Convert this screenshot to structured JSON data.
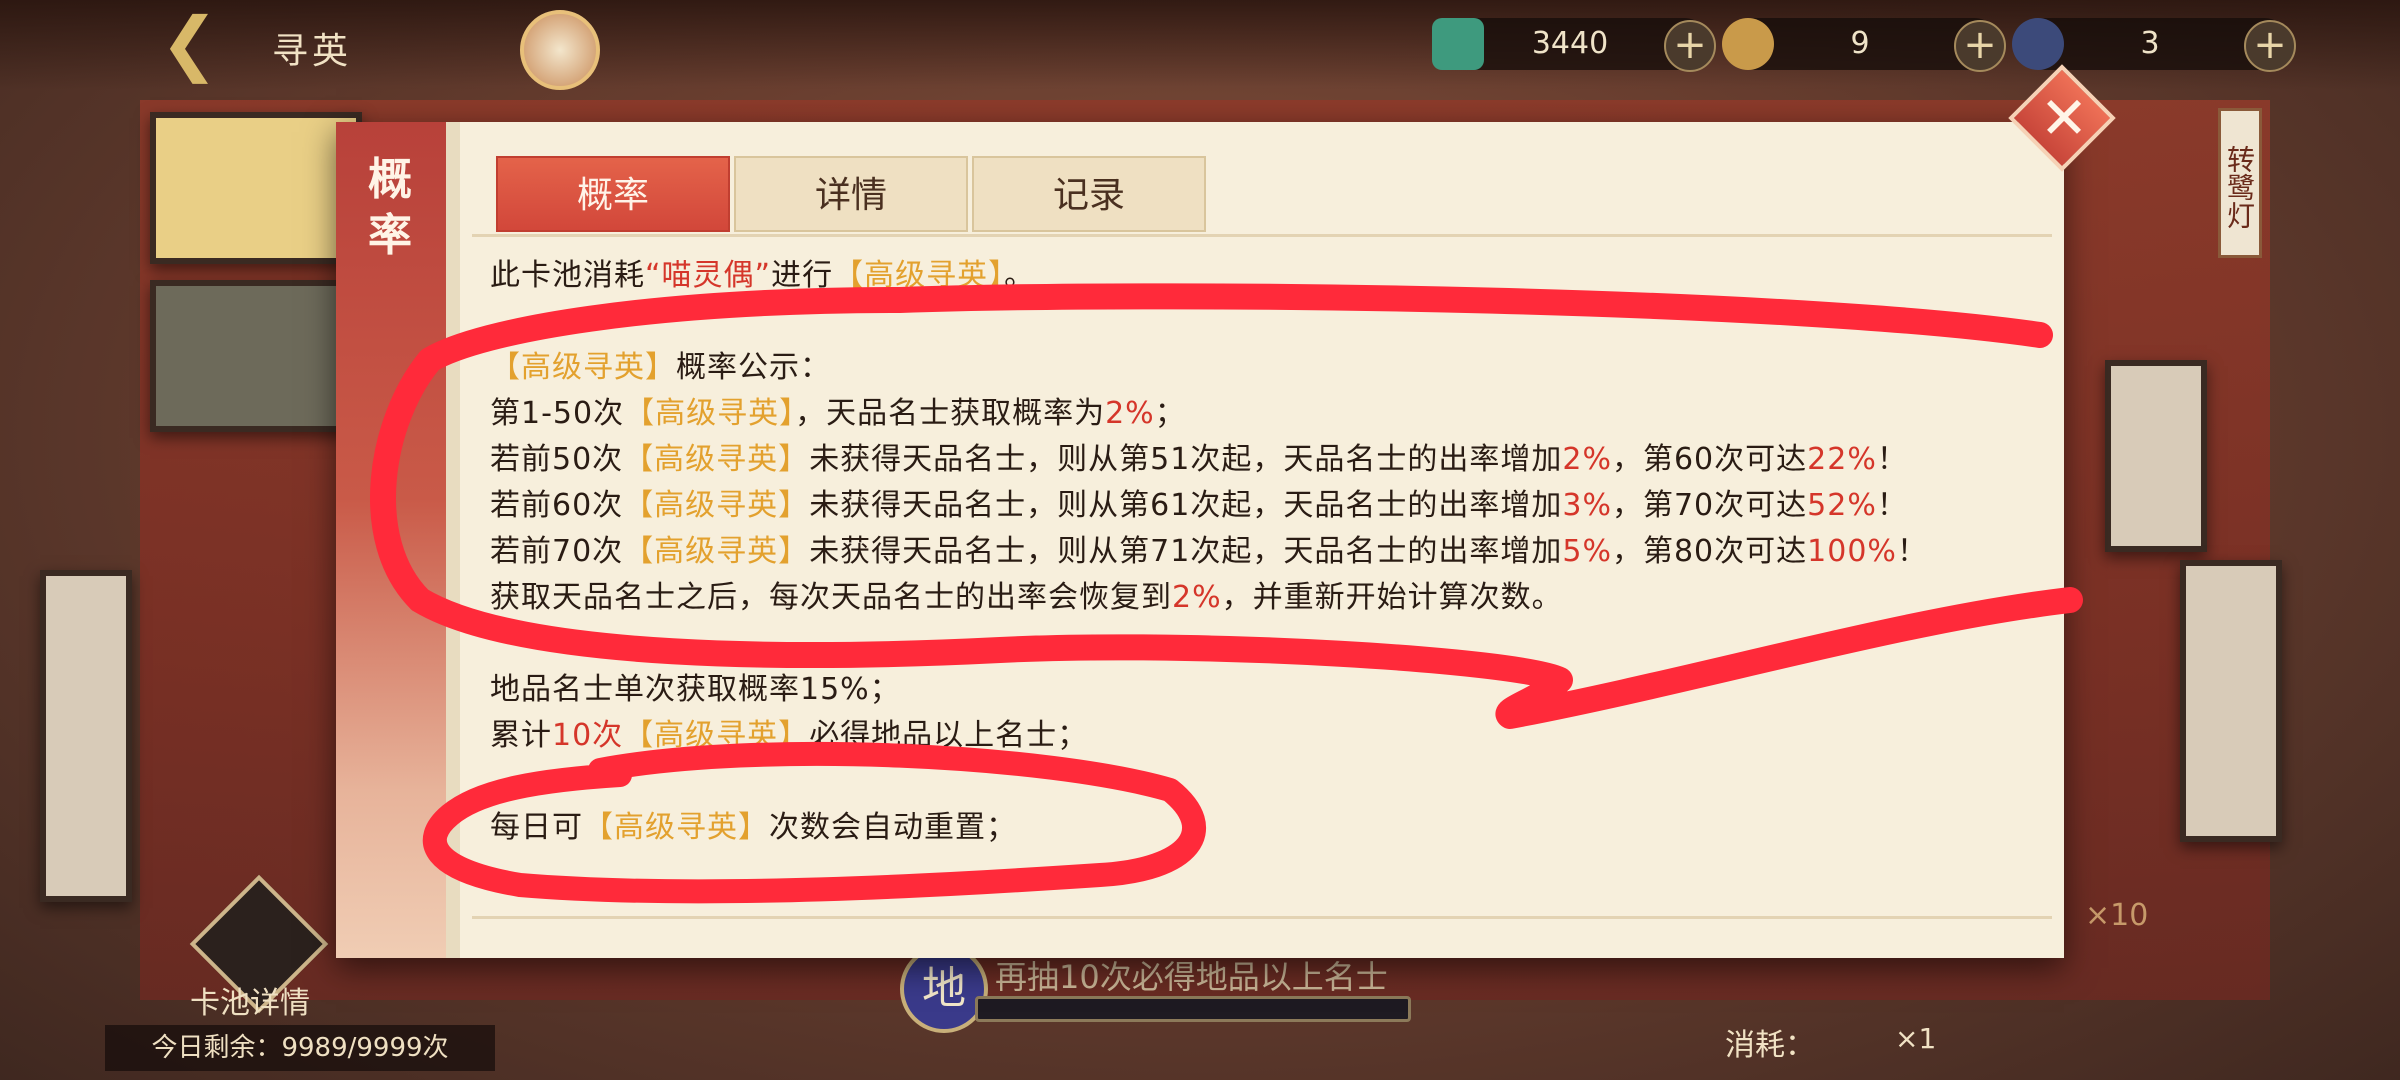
{
  "header": {
    "title": "寻英",
    "back_icon": "back-arrow-icon",
    "currencies": [
      {
        "icon": "jade-icon",
        "value": "3440"
      },
      {
        "icon": "cat-doll-icon",
        "value": "9"
      },
      {
        "icon": "wolf-token-icon",
        "value": "3"
      }
    ],
    "plus_label": "+"
  },
  "background": {
    "pool_details_label": "卡池详情",
    "daily_remaining": "今日剩余：9989/9999次",
    "bottom_badge": "地",
    "bottom_hint": "再抽10次必得地品以上名士",
    "cost_label": "消耗：",
    "cost_mult": "×1",
    "side_mult": "×10",
    "lantern_label": "转鹭灯"
  },
  "modal": {
    "side_title": "概率",
    "tabs": [
      {
        "label": "概率",
        "active": true
      },
      {
        "label": "详情",
        "active": false
      },
      {
        "label": "记录",
        "active": false
      }
    ],
    "close_label": "✕",
    "content": {
      "l1": {
        "a": "此卡池消耗",
        "b": "“喵灵偶”",
        "c": "进行",
        "d": "【高级寻英】",
        "e": "。"
      },
      "l2": {
        "a": "【高级寻英】",
        "b": "概率公示："
      },
      "l3": {
        "a": "第1-50次",
        "b": "【高级寻英】",
        "c": "，天品名士获取概率为",
        "d": "2%",
        "e": "；"
      },
      "l4": {
        "a": "若前50次",
        "b": "【高级寻英】",
        "c": "未获得天品名士，则从第51次起，天品名士的出率增加",
        "d": "2%",
        "e": "，第60次可达",
        "f": "22%",
        "g": "！"
      },
      "l5": {
        "a": "若前60次",
        "b": "【高级寻英】",
        "c": "未获得天品名士，则从第61次起，天品名士的出率增加",
        "d": "3%",
        "e": "，第70次可达",
        "f": "52%",
        "g": "！"
      },
      "l6": {
        "a": "若前70次",
        "b": "【高级寻英】",
        "c": "未获得天品名士，则从第71次起，天品名士的出率增加",
        "d": "5%",
        "e": "，第80次可达",
        "f": "100%",
        "g": "！"
      },
      "l7": {
        "a": "获取天品名士之后，每次天品名士的出率会恢复到",
        "b": "2%",
        "c": "，并重新开始计算次数。"
      },
      "l8": {
        "a": "地品名士单次获取概率15%；"
      },
      "l9": {
        "a": "累计",
        "b": "10次",
        "c": "【高级寻英】",
        "d": "必得地品以上名士；"
      },
      "l10": {
        "a": "每日可",
        "b": "【高级寻英】",
        "c": "次数会自动重置；"
      }
    }
  },
  "colors": {
    "highlight": "#e3a12e",
    "red": "#d5362a",
    "annotation": "#ff2a3a"
  }
}
